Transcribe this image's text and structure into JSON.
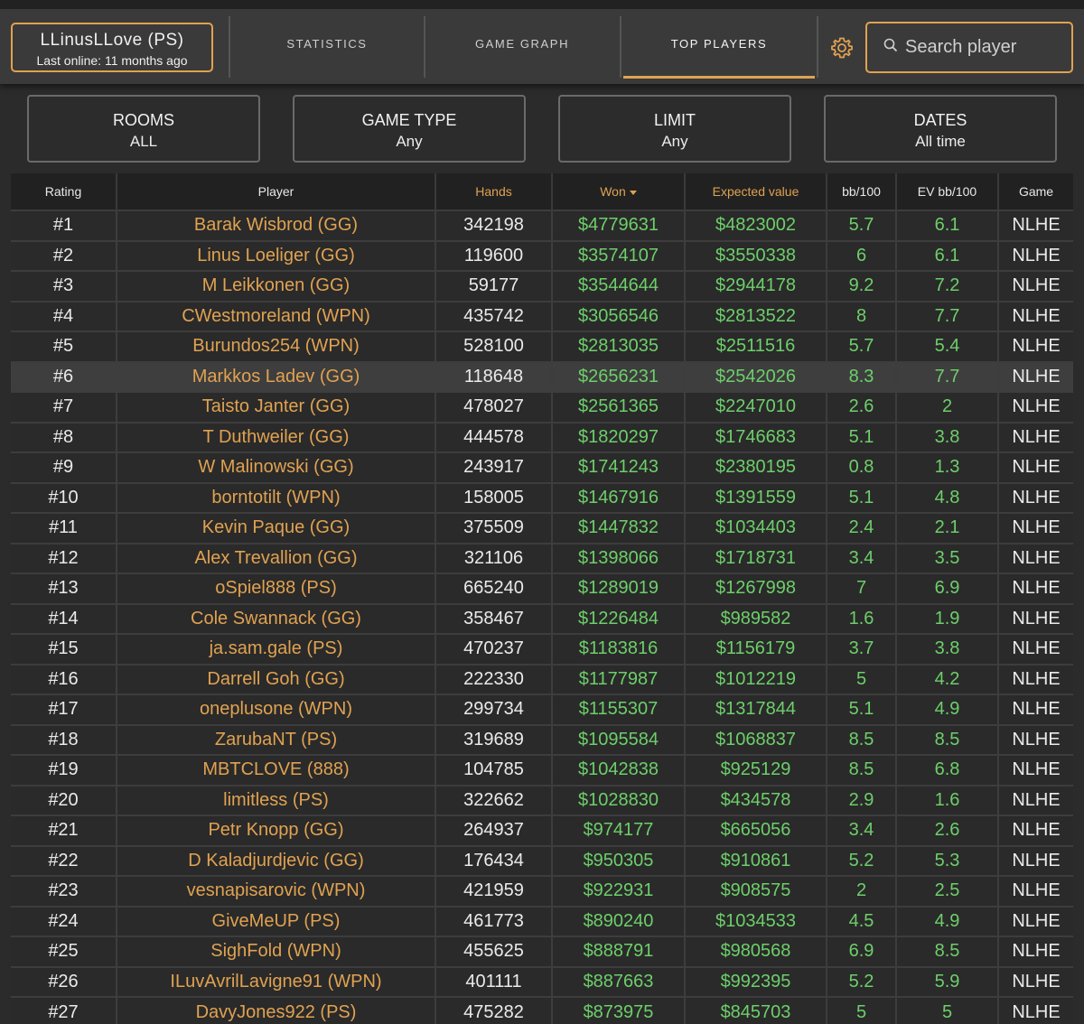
{
  "profile": {
    "name": "LLinusLLove (PS)",
    "last_online": "Last online: 11 months ago"
  },
  "nav": {
    "tabs": [
      {
        "label": "STATISTICS"
      },
      {
        "label": "GAME GRAPH"
      },
      {
        "label": "TOP PLAYERS"
      }
    ]
  },
  "icons": {
    "settings": "gear-icon",
    "search": "search-icon",
    "sort": "sort-desc-icon"
  },
  "search": {
    "placeholder": "Search player"
  },
  "filters": [
    {
      "title": "ROOMS",
      "value": "ALL"
    },
    {
      "title": "GAME TYPE",
      "value": "Any"
    },
    {
      "title": "LIMIT",
      "value": "Any"
    },
    {
      "title": "DATES",
      "value": "All time"
    }
  ],
  "table": {
    "headers": {
      "rating": "Rating",
      "player": "Player",
      "hands": "Hands",
      "won": "Won",
      "ev": "Expected value",
      "bb100": "bb/100",
      "evbb100": "EV bb/100",
      "game": "Game"
    },
    "highlighted_row": 6,
    "rows": [
      {
        "rating": "#1",
        "player": "Barak Wisbrod (GG)",
        "hands": "342198",
        "won": "$4779631",
        "ev": "$4823002",
        "bb100": "5.7",
        "evbb100": "6.1",
        "game": "NLHE"
      },
      {
        "rating": "#2",
        "player": "Linus Loeliger (GG)",
        "hands": "119600",
        "won": "$3574107",
        "ev": "$3550338",
        "bb100": "6",
        "evbb100": "6.1",
        "game": "NLHE"
      },
      {
        "rating": "#3",
        "player": "M Leikkonen (GG)",
        "hands": "59177",
        "won": "$3544644",
        "ev": "$2944178",
        "bb100": "9.2",
        "evbb100": "7.2",
        "game": "NLHE"
      },
      {
        "rating": "#4",
        "player": "CWestmoreland (WPN)",
        "hands": "435742",
        "won": "$3056546",
        "ev": "$2813522",
        "bb100": "8",
        "evbb100": "7.7",
        "game": "NLHE"
      },
      {
        "rating": "#5",
        "player": "Burundos254 (WPN)",
        "hands": "528100",
        "won": "$2813035",
        "ev": "$2511516",
        "bb100": "5.7",
        "evbb100": "5.4",
        "game": "NLHE"
      },
      {
        "rating": "#6",
        "player": "Markkos Ladev (GG)",
        "hands": "118648",
        "won": "$2656231",
        "ev": "$2542026",
        "bb100": "8.3",
        "evbb100": "7.7",
        "game": "NLHE"
      },
      {
        "rating": "#7",
        "player": "Taisto Janter (GG)",
        "hands": "478027",
        "won": "$2561365",
        "ev": "$2247010",
        "bb100": "2.6",
        "evbb100": "2",
        "game": "NLHE"
      },
      {
        "rating": "#8",
        "player": "T Duthweiler (GG)",
        "hands": "444578",
        "won": "$1820297",
        "ev": "$1746683",
        "bb100": "5.1",
        "evbb100": "3.8",
        "game": "NLHE"
      },
      {
        "rating": "#9",
        "player": "W Malinowski (GG)",
        "hands": "243917",
        "won": "$1741243",
        "ev": "$2380195",
        "bb100": "0.8",
        "evbb100": "1.3",
        "game": "NLHE"
      },
      {
        "rating": "#10",
        "player": "borntotilt (WPN)",
        "hands": "158005",
        "won": "$1467916",
        "ev": "$1391559",
        "bb100": "5.1",
        "evbb100": "4.8",
        "game": "NLHE"
      },
      {
        "rating": "#11",
        "player": "Kevin Paque (GG)",
        "hands": "375509",
        "won": "$1447832",
        "ev": "$1034403",
        "bb100": "2.4",
        "evbb100": "2.1",
        "game": "NLHE"
      },
      {
        "rating": "#12",
        "player": "Alex Trevallion (GG)",
        "hands": "321106",
        "won": "$1398066",
        "ev": "$1718731",
        "bb100": "3.4",
        "evbb100": "3.5",
        "game": "NLHE"
      },
      {
        "rating": "#13",
        "player": "oSpiel888 (PS)",
        "hands": "665240",
        "won": "$1289019",
        "ev": "$1267998",
        "bb100": "7",
        "evbb100": "6.9",
        "game": "NLHE"
      },
      {
        "rating": "#14",
        "player": "Cole Swannack (GG)",
        "hands": "358467",
        "won": "$1226484",
        "ev": "$989582",
        "bb100": "1.6",
        "evbb100": "1.9",
        "game": "NLHE"
      },
      {
        "rating": "#15",
        "player": "ja.sam.gale (PS)",
        "hands": "470237",
        "won": "$1183816",
        "ev": "$1156179",
        "bb100": "3.7",
        "evbb100": "3.8",
        "game": "NLHE"
      },
      {
        "rating": "#16",
        "player": "Darrell Goh (GG)",
        "hands": "222330",
        "won": "$1177987",
        "ev": "$1012219",
        "bb100": "5",
        "evbb100": "4.2",
        "game": "NLHE"
      },
      {
        "rating": "#17",
        "player": "oneplusone (WPN)",
        "hands": "299734",
        "won": "$1155307",
        "ev": "$1317844",
        "bb100": "5.1",
        "evbb100": "4.9",
        "game": "NLHE"
      },
      {
        "rating": "#18",
        "player": "ZarubaNT (PS)",
        "hands": "319689",
        "won": "$1095584",
        "ev": "$1068837",
        "bb100": "8.5",
        "evbb100": "8.5",
        "game": "NLHE"
      },
      {
        "rating": "#19",
        "player": "MBTCLOVE (888)",
        "hands": "104785",
        "won": "$1042838",
        "ev": "$925129",
        "bb100": "8.5",
        "evbb100": "6.8",
        "game": "NLHE"
      },
      {
        "rating": "#20",
        "player": "limitless (PS)",
        "hands": "322662",
        "won": "$1028830",
        "ev": "$434578",
        "bb100": "2.9",
        "evbb100": "1.6",
        "game": "NLHE"
      },
      {
        "rating": "#21",
        "player": "Petr Knopp (GG)",
        "hands": "264937",
        "won": "$974177",
        "ev": "$665056",
        "bb100": "3.4",
        "evbb100": "2.6",
        "game": "NLHE"
      },
      {
        "rating": "#22",
        "player": "D Kaladjurdjevic (GG)",
        "hands": "176434",
        "won": "$950305",
        "ev": "$910861",
        "bb100": "5.2",
        "evbb100": "5.3",
        "game": "NLHE"
      },
      {
        "rating": "#23",
        "player": "vesnapisarovic (WPN)",
        "hands": "421959",
        "won": "$922931",
        "ev": "$908575",
        "bb100": "2",
        "evbb100": "2.5",
        "game": "NLHE"
      },
      {
        "rating": "#24",
        "player": "GiveMeUP (PS)",
        "hands": "461773",
        "won": "$890240",
        "ev": "$1034533",
        "bb100": "4.5",
        "evbb100": "4.9",
        "game": "NLHE"
      },
      {
        "rating": "#25",
        "player": "SighFold (WPN)",
        "hands": "455625",
        "won": "$888791",
        "ev": "$980568",
        "bb100": "6.9",
        "evbb100": "8.5",
        "game": "NLHE"
      },
      {
        "rating": "#26",
        "player": "ILuvAvrilLavigne91 (WPN)",
        "hands": "401111",
        "won": "$887663",
        "ev": "$992395",
        "bb100": "5.2",
        "evbb100": "5.9",
        "game": "NLHE"
      },
      {
        "rating": "#27",
        "player": "DavyJones922 (PS)",
        "hands": "475282",
        "won": "$873975",
        "ev": "$845703",
        "bb100": "5",
        "evbb100": "5",
        "game": "NLHE"
      }
    ]
  }
}
